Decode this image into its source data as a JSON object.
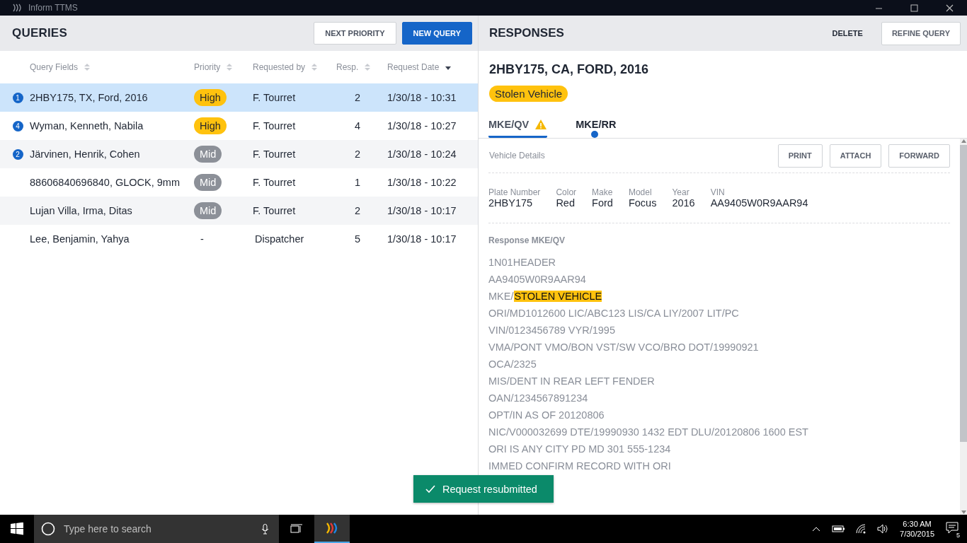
{
  "window": {
    "title": "Inform TTMS"
  },
  "queries": {
    "title": "QUERIES",
    "buttons": [
      {
        "label": "NEXT PRIORITY",
        "primary": false
      },
      {
        "label": "NEW QUERY",
        "primary": true
      }
    ],
    "columns": [
      {
        "label": "Query Fields",
        "sorted": false
      },
      {
        "label": "Priority",
        "sorted": false
      },
      {
        "label": "Requested by",
        "sorted": false
      },
      {
        "label": "Resp.",
        "sorted": false
      },
      {
        "label": "Request Date",
        "sorted": true
      }
    ],
    "rows": [
      {
        "badge": "1",
        "fields": "2HBY175, TX, Ford, 2016",
        "priority": {
          "label": "High",
          "color": "#ffc20e"
        },
        "requested_by": "F. Tourret",
        "resp": "2",
        "date": "1/30/18 - 10:31",
        "selected": true
      },
      {
        "badge": "4",
        "fields": "Wyman, Kenneth, Nabila",
        "priority": {
          "label": "High",
          "color": "#ffc20e"
        },
        "requested_by": "F. Tourret",
        "resp": "4",
        "date": "1/30/18 - 10:27",
        "selected": false
      },
      {
        "badge": "2",
        "fields": "Järvinen, Henrik, Cohen",
        "priority": {
          "label": "Mid",
          "color": "#8c9098"
        },
        "requested_by": "F. Tourret",
        "resp": "2",
        "date": "1/30/18 - 10:24",
        "selected": false
      },
      {
        "fields": "88606840696840, GLOCK, 9mm",
        "priority": {
          "label": "Mid",
          "color": "#8c9098"
        },
        "requested_by": "F. Tourret",
        "resp": "1",
        "date": "1/30/18 - 10:22",
        "selected": false
      },
      {
        "fields": "Lujan Villa, Irma, Ditas",
        "priority": {
          "label": "Mid",
          "color": "#8c9098"
        },
        "requested_by": "F. Tourret",
        "resp": "2",
        "date": "1/30/18 - 10:17",
        "selected": false
      },
      {
        "fields": "Lee, Benjamin, Yahya",
        "priority": {
          "label": "-"
        },
        "requested_by": "Dispatcher",
        "resp": "5",
        "date": "1/30/18 - 10:17",
        "selected": false
      }
    ]
  },
  "responses": {
    "title": "RESPONSES",
    "buttons": [
      {
        "label": "DELETE",
        "outlined": false
      },
      {
        "label": "REFINE QUERY",
        "outlined": true
      }
    ],
    "heading": "2HBY175, CA, FORD, 2016",
    "tag": "Stolen Vehicle",
    "tabs": [
      {
        "label": "MKE/QV",
        "selected": true,
        "warning": true,
        "unread": false
      },
      {
        "label": "MKE/RR",
        "selected": false,
        "warning": false,
        "unread": true
      }
    ],
    "section_title": "Vehicle Details",
    "actions": [
      "PRINT",
      "ATTACH",
      "FORWARD"
    ],
    "details": [
      {
        "label": "Plate Number",
        "value": "2HBY175"
      },
      {
        "label": "Color",
        "value": "Red"
      },
      {
        "label": "Make",
        "value": "Ford"
      },
      {
        "label": "Model",
        "value": "Focus"
      },
      {
        "label": "Year",
        "value": "2016"
      },
      {
        "label": "VIN",
        "value": "AA9405W0R9AAR94"
      }
    ],
    "response_title": "Response MKE/QV",
    "lines": [
      {
        "text": "1N01HEADER"
      },
      {
        "text": "AA9405W0R9AAR94"
      },
      {
        "text": "MKE/",
        "highlight": "STOLEN VEHICLE"
      },
      {
        "text": "ORI/MD1012600 LIC/ABC123 LIS/CA LIY/2007 LIT/PC"
      },
      {
        "text": "VIN/0123456789 VYR/1995"
      },
      {
        "text": "VMA/PONT VMO/BON VST/SW VCO/BRO DOT/19990921"
      },
      {
        "text": "OCA/2325"
      },
      {
        "text": "MIS/DENT IN REAR LEFT FENDER"
      },
      {
        "text": "OAN/1234567891234"
      },
      {
        "text": "OPT/IN AS OF 20120806"
      },
      {
        "text": "NIC/V000032699 DTE/19990930 1432 EDT DLU/20120806 1600 EST"
      },
      {
        "text": "ORI IS ANY CITY PD MD 301 555-1234"
      },
      {
        "text": "IMMED CONFIRM RECORD WITH ORI"
      }
    ]
  },
  "toast": {
    "message": "Request resubmitted"
  },
  "taskbar": {
    "search_placeholder": "Type here to search",
    "time": "6:30 AM",
    "date": "7/30/2015",
    "notifications": "5"
  }
}
